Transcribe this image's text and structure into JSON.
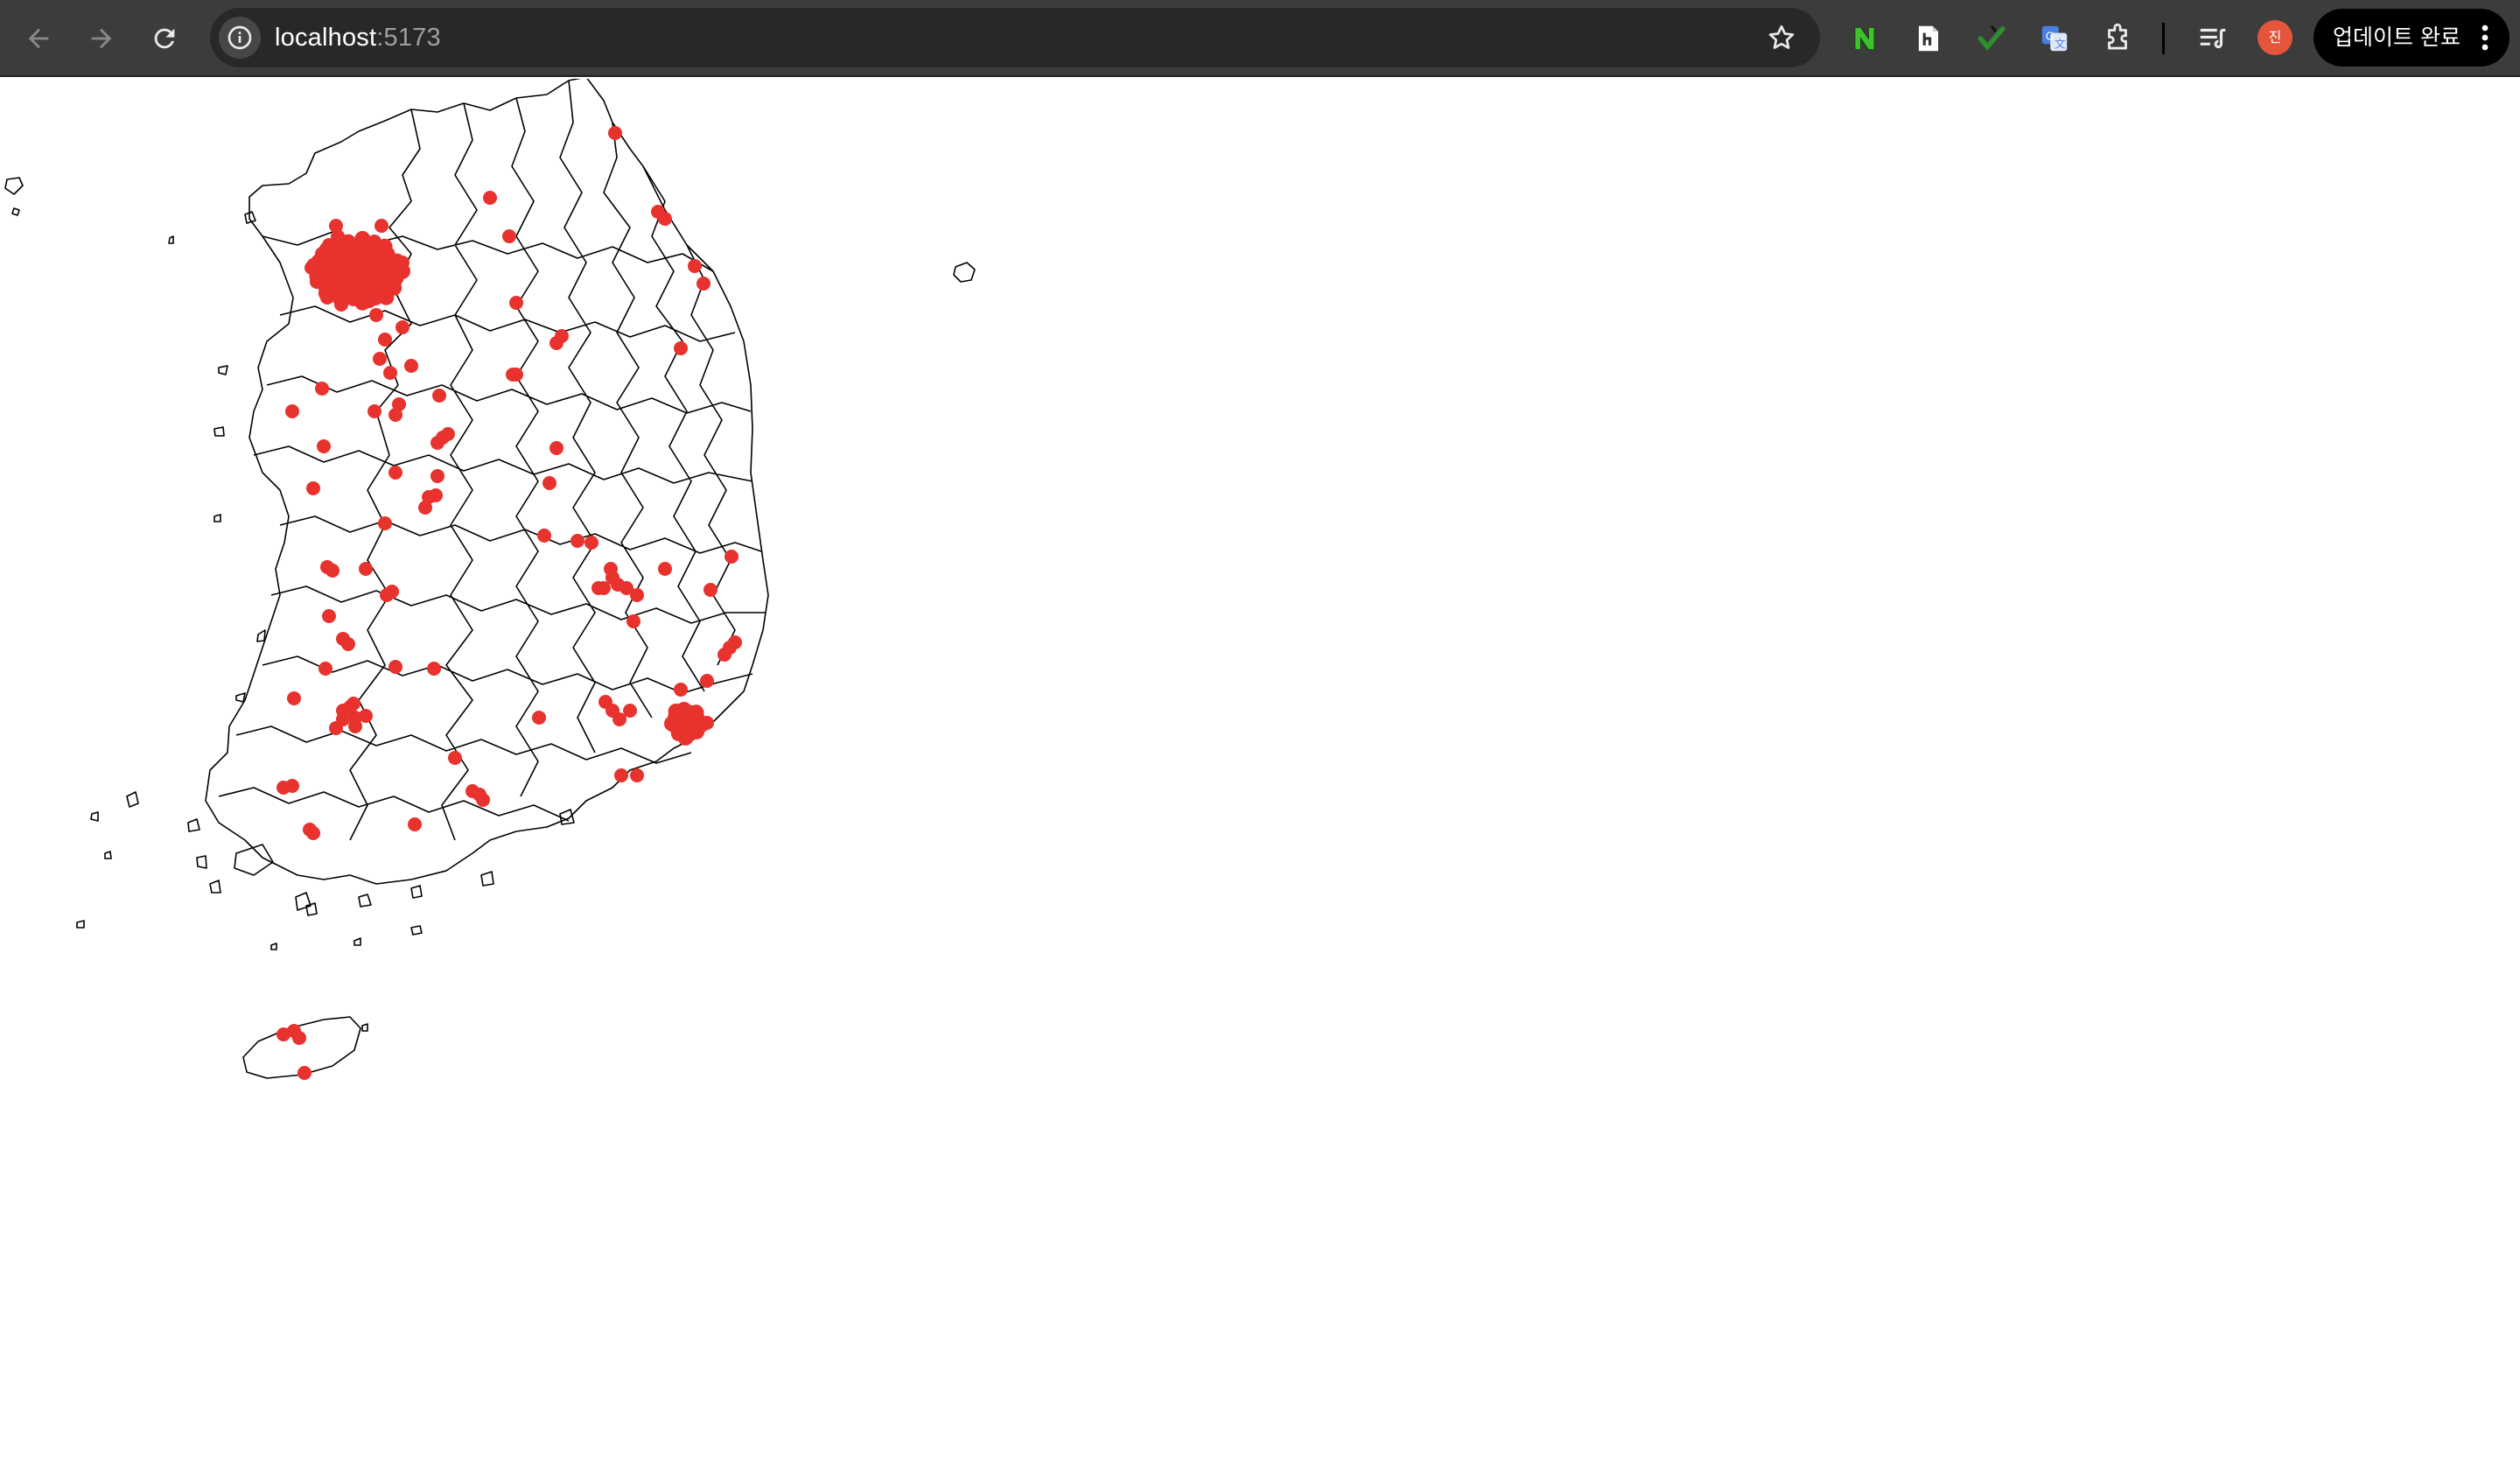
{
  "browser": {
    "url_host": "localhost",
    "url_port": ":5173",
    "update_button_label": "업데이트 완료",
    "profile_initial": "진",
    "extensions": [
      {
        "icon": "naver-n-icon",
        "letter": "N",
        "color": "#3ec12f"
      },
      {
        "icon": "hwp-viewer-icon",
        "letter": "h",
        "color": "#ffffff"
      },
      {
        "icon": "checkmark-extension-icon",
        "color": "#2f8f2f"
      },
      {
        "icon": "google-translate-icon",
        "color": "#4a7fe0"
      },
      {
        "icon": "puzzle-extensions-icon",
        "color": "#e8eaed"
      },
      {
        "icon": "reading-list-icon",
        "color": "#e8eaed"
      }
    ]
  },
  "map": {
    "type": "choropleth-outline-with-points",
    "region": "South Korea municipal boundaries",
    "boundary_color": "#000000",
    "point_color": "#e8322e",
    "background": "#ffffff"
  }
}
